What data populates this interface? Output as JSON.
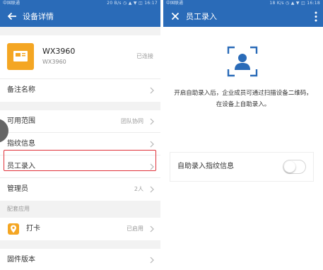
{
  "left": {
    "status_bar": {
      "carrier": "中国联通",
      "right": "20 B/s ◷ ▲ ▼ ◫ 16:17"
    },
    "title": "设备详情",
    "device": {
      "name": "WX3960",
      "model": "WX3960",
      "status": "已连接"
    },
    "rows": {
      "remark": "备注名称",
      "scope": "可用范围",
      "scope_value": "团队协同",
      "fingerprint": "指纹信息",
      "enroll": "员工录入",
      "admin": "管理员",
      "admin_value": "2人"
    },
    "section_label": "配套应用",
    "app": {
      "name": "打卡",
      "status": "已启用"
    },
    "firmware": "固件版本"
  },
  "right": {
    "status_bar": {
      "carrier": "中国联通",
      "right": "18 K/s ◷ ▲ ▼ ◫ 16:18"
    },
    "title": "员工录入",
    "description": "开启自助录入后，企业成员可通过扫描设备二维码，在设备上自助录入。",
    "toggle": {
      "label": "自助录入指纹信息",
      "enabled": false
    }
  },
  "colors": {
    "primary": "#2a6bb8",
    "accent": "#f4a623",
    "highlight": "#e0323a"
  },
  "icons": {
    "left_nav": "back-arrow-icon",
    "right_nav": "close-icon",
    "right_more": "more-vertical-icon",
    "device": "device-icon",
    "app": "location-pin-icon",
    "scan": "scan-person-icon",
    "row": "chevron-right-icon"
  }
}
